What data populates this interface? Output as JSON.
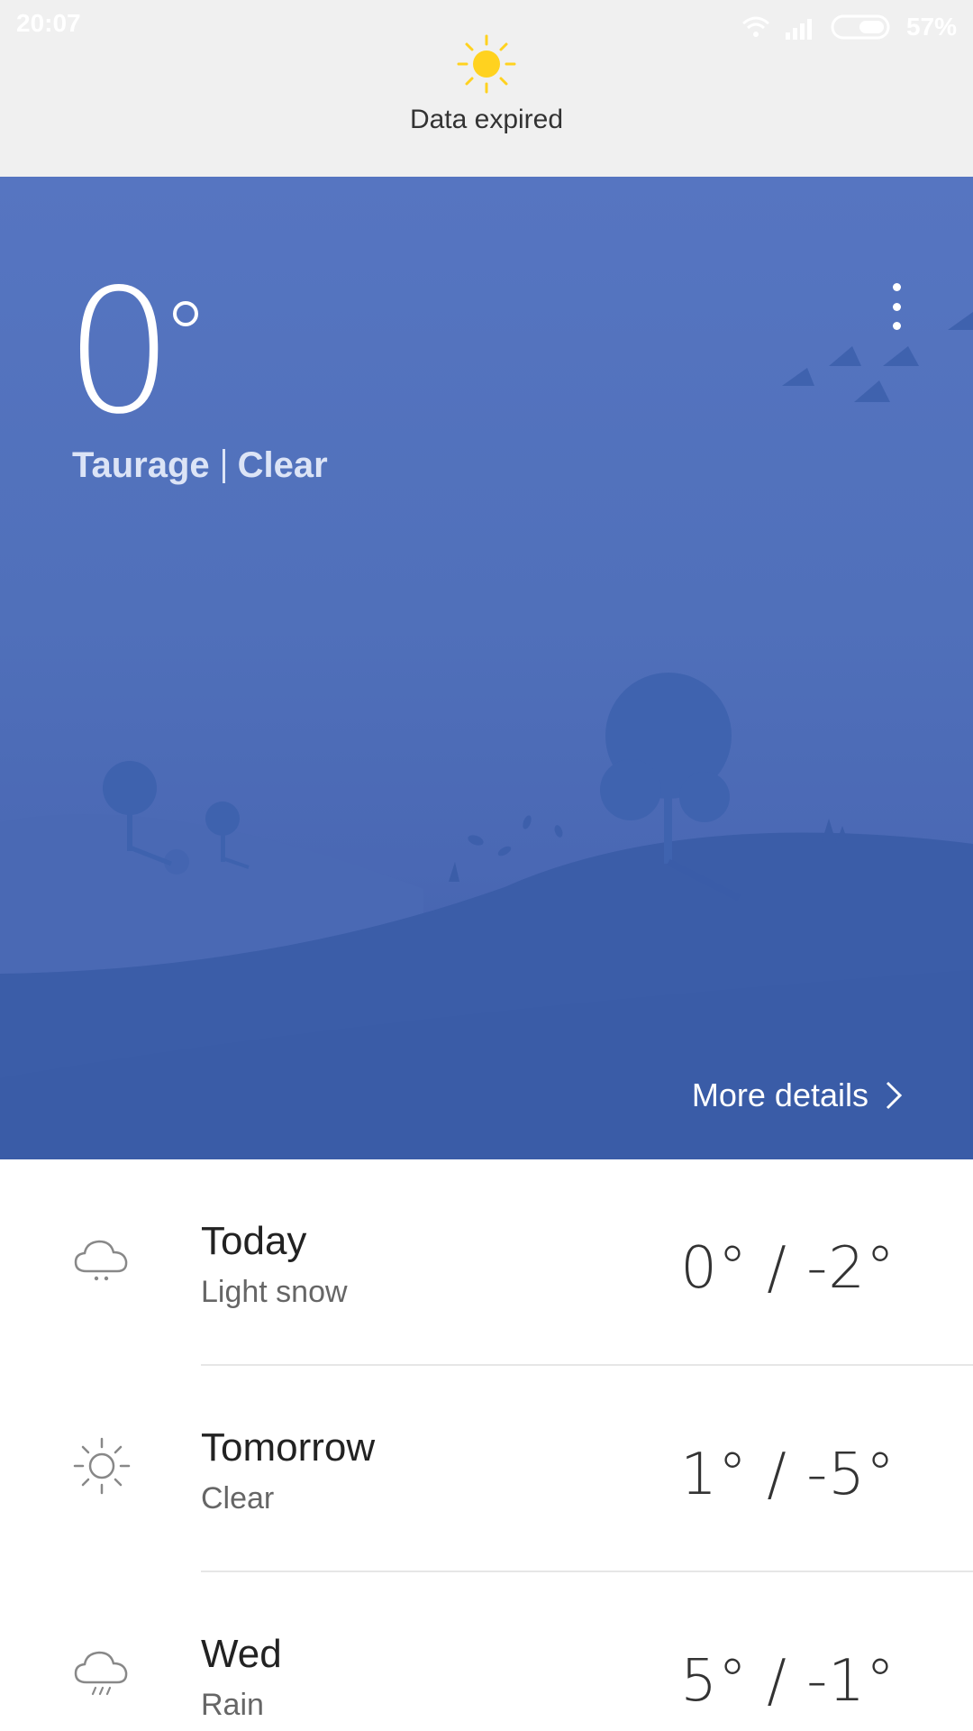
{
  "status_bar": {
    "time": "20:07",
    "battery_percent": "57%",
    "wifi_icon": "wifi-icon",
    "signal_icon": "signal-icon",
    "battery_icon": "battery-icon"
  },
  "banner": {
    "icon": "sun-icon",
    "text": "Data expired"
  },
  "current": {
    "temperature": "0",
    "location": "Taurage",
    "condition": "Clear",
    "more_details_label": "More details"
  },
  "colors": {
    "sun": "#ffd21f",
    "hero_top": "#5675c1",
    "hero_bottom": "#3d5ea8"
  },
  "forecast": [
    {
      "day": "Today",
      "condition": "Light snow",
      "temps": "0° / -2°",
      "icon": "cloud-snow-icon"
    },
    {
      "day": "Tomorrow",
      "condition": "Clear",
      "temps": "1° / -5°",
      "icon": "sun-outline-icon"
    },
    {
      "day": "Wed",
      "condition": "Rain",
      "temps": "5° / -1°",
      "icon": "cloud-rain-icon"
    }
  ]
}
